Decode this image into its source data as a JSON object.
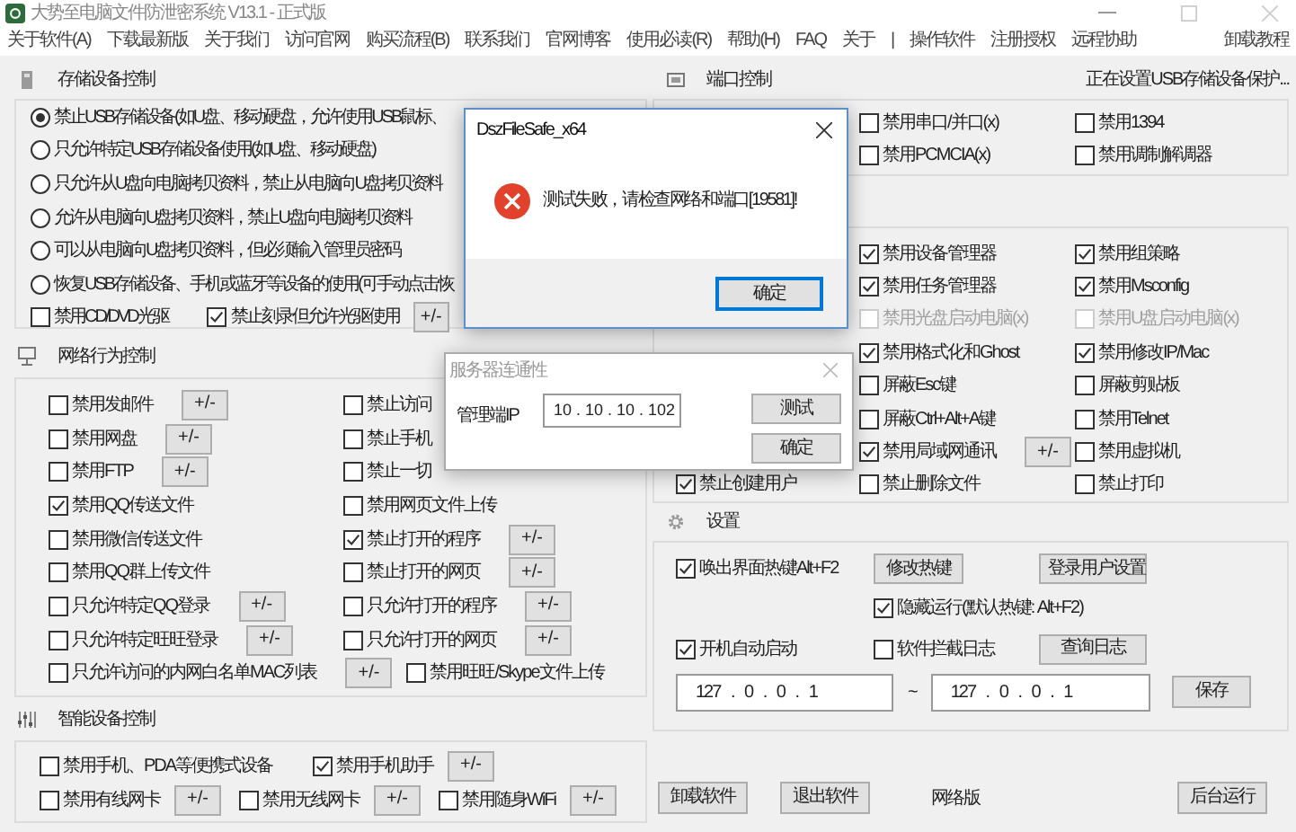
{
  "window": {
    "title": "大势至电脑文件防泄密系统 V13.1 - 正式版",
    "menu": [
      "关于软件(A)",
      "下载最新版",
      "关于我们",
      "访问官网",
      "购买流程(B)",
      "联系我们",
      "官网博客",
      "使用必读(R)",
      "帮助(H)",
      "FAQ",
      "关于",
      "|",
      "操作软件",
      "注册授权",
      "远程协助"
    ],
    "menu_right": "卸载教程"
  },
  "storage": {
    "title": "存储设备控制",
    "options": [
      {
        "label": "禁止USB存储设备(如U盘、移动硬盘，允许使用USB鼠标、",
        "selected": true
      },
      {
        "label": "只允许特定USB存储设备使用(如U盘、移动硬盘)",
        "selected": false
      },
      {
        "label": "只允许从U盘向电脑拷贝资料，禁止从电脑向U盘拷贝资料",
        "selected": false
      },
      {
        "label": "允许从电脑向U盘拷贝资料，禁止U盘向电脑拷贝资料",
        "selected": false
      },
      {
        "label": "可以从电脑向U盘拷贝资料，但必须输入管理员密码",
        "selected": false
      },
      {
        "label": "恢复USB存储设备、手机或蓝牙等设备的使用(可手动点击恢",
        "selected": false
      }
    ],
    "extras": [
      {
        "label": "禁用CD/DVD光驱",
        "checked": false
      },
      {
        "label": "禁止刻录但允许光驱使用",
        "checked": true,
        "button": "+/-"
      }
    ]
  },
  "network": {
    "title": "网络行为控制",
    "rows": [
      [
        {
          "label": "禁用发邮件",
          "checked": false,
          "button": "+/-"
        },
        {
          "label": "禁止访问",
          "checked": false
        }
      ],
      [
        {
          "label": "禁用网盘",
          "checked": false,
          "button": "+/-"
        },
        {
          "label": "禁止手机",
          "checked": false
        }
      ],
      [
        {
          "label": "禁用FTP",
          "checked": false,
          "button": "+/-"
        },
        {
          "label": "禁止一切",
          "checked": false
        }
      ],
      [
        {
          "label": "禁用QQ传送文件",
          "checked": true
        },
        {
          "label": "禁用网页文件上传",
          "checked": false
        }
      ],
      [
        {
          "label": "禁用微信传送文件",
          "checked": false
        },
        {
          "label": "禁止打开的程序",
          "checked": true,
          "button": "+/-"
        }
      ],
      [
        {
          "label": "禁用QQ群上传文件",
          "checked": false
        },
        {
          "label": "禁止打开的网页",
          "checked": false,
          "button": "+/-"
        }
      ],
      [
        {
          "label": "只允许特定QQ登录",
          "checked": false,
          "button": "+/-"
        },
        {
          "label": "只允许打开的程序",
          "checked": false,
          "button": "+/-"
        }
      ],
      [
        {
          "label": "只允许特定旺旺登录",
          "checked": false,
          "button": "+/-"
        },
        {
          "label": "只允许打开的网页",
          "checked": false,
          "button": "+/-"
        }
      ],
      [
        {
          "label": "只允许访问的内网白名单MAC列表",
          "checked": false,
          "button": "+/-"
        },
        {
          "label": "禁用旺旺/Skype文件上传",
          "checked": false
        }
      ]
    ]
  },
  "smart": {
    "title": "智能设备控制",
    "rows": [
      [
        {
          "label": "禁用手机、PDA等便携式设备",
          "checked": false
        },
        {
          "label": "禁用手机助手",
          "checked": true,
          "button": "+/-"
        }
      ],
      [
        {
          "label": "禁用有线网卡",
          "checked": false,
          "button": "+/-"
        },
        {
          "label": "禁用无线网卡",
          "checked": false,
          "button": "+/-"
        },
        {
          "label": "禁用随身WiFi",
          "checked": false,
          "button": "+/-"
        }
      ]
    ]
  },
  "ports": {
    "title": "端口控制",
    "status": "正在设置USB存储设备保护...",
    "rows": [
      {
        "column_2": {
          "label": "禁用串口/并口(x)",
          "checked": false
        },
        "column_3": {
          "label": "禁用1394",
          "checked": false
        }
      },
      {
        "column_2": {
          "label": "禁用PCMCIA(x)",
          "checked": false
        },
        "column_3": {
          "label": "禁用调制解调器",
          "checked": false
        }
      }
    ]
  },
  "security": {
    "rows": [
      {
        "column_2": {
          "label": "禁用设备管理器",
          "checked": true,
          "disabled": false
        },
        "column_3": {
          "label": "禁用组策略",
          "checked": true,
          "disabled": false
        }
      },
      {
        "column_2": {
          "label": "禁用任务管理器",
          "checked": true,
          "disabled": false
        },
        "column_3": {
          "label": "禁用Msconfig",
          "checked": true,
          "disabled": false
        }
      },
      {
        "column_2": {
          "label": "禁用光盘启动电脑(x)",
          "checked": false,
          "disabled": true
        },
        "column_3": {
          "label": "禁用U盘启动电脑(x)",
          "checked": false,
          "disabled": true
        }
      },
      {
        "column_2": {
          "label": "禁用格式化和Ghost",
          "checked": true,
          "disabled": false
        },
        "column_3": {
          "label": "禁用修改IP/Mac",
          "checked": true,
          "disabled": false
        }
      },
      {
        "column_2": {
          "label": "屏蔽Esc键",
          "checked": false,
          "disabled": false
        },
        "column_3": {
          "label": "屏蔽剪贴板",
          "checked": false,
          "disabled": false
        }
      },
      {
        "column_2": {
          "label": "屏蔽Ctrl+Alt+A键",
          "checked": false,
          "disabled": false
        },
        "column_3": {
          "label": "禁用Telnet",
          "checked": false,
          "disabled": false
        }
      },
      {
        "column_2": {
          "label": "禁用局域网通讯",
          "checked": true,
          "disabled": false,
          "button": "+/-"
        },
        "column_3": {
          "label": "禁用虚拟机",
          "checked": false,
          "disabled": false
        }
      },
      {
        "column_1": {
          "label": "禁止创建用户",
          "checked": true,
          "disabled": false
        },
        "column_2": {
          "label": "禁止删除文件",
          "checked": false,
          "disabled": false
        },
        "column_3": {
          "label": "禁止打印",
          "checked": false,
          "disabled": false
        }
      }
    ]
  },
  "settings": {
    "title": "设置",
    "hotkey": {
      "label": "唤出界面热键Alt+F2",
      "checked": true
    },
    "hotkey_buttons": [
      "修改热键",
      "登录用户设置"
    ],
    "hidden_run": {
      "label": "隐藏运行(默认热键: Alt+F2)",
      "checked": true
    },
    "autostart": {
      "label": "开机自动启动",
      "checked": true
    },
    "log": {
      "label": "软件拦截日志",
      "checked": false
    },
    "log_button": "查询日志",
    "ip_from": "127 . 0 . 0 . 1",
    "range_sign": "~",
    "ip_to": "127 . 0 . 0 . 1",
    "save_button": "保存"
  },
  "footer": [
    {
      "kind": "button",
      "label": "卸载软件"
    },
    {
      "kind": "button",
      "label": "退出软件"
    },
    {
      "kind": "text",
      "label": "网络版"
    },
    {
      "kind": "button",
      "label": "后台运行"
    }
  ],
  "error_dialog": {
    "title": "DszFileSafe_x64",
    "message": "测试失败，请检查网络和端口[19581]!",
    "button": "确定"
  },
  "server_dialog": {
    "title": "服务器连通性",
    "label": "管理端IP",
    "ip": "10 . 10 . 10 . 102",
    "buttons": [
      "测试",
      "确定"
    ]
  }
}
